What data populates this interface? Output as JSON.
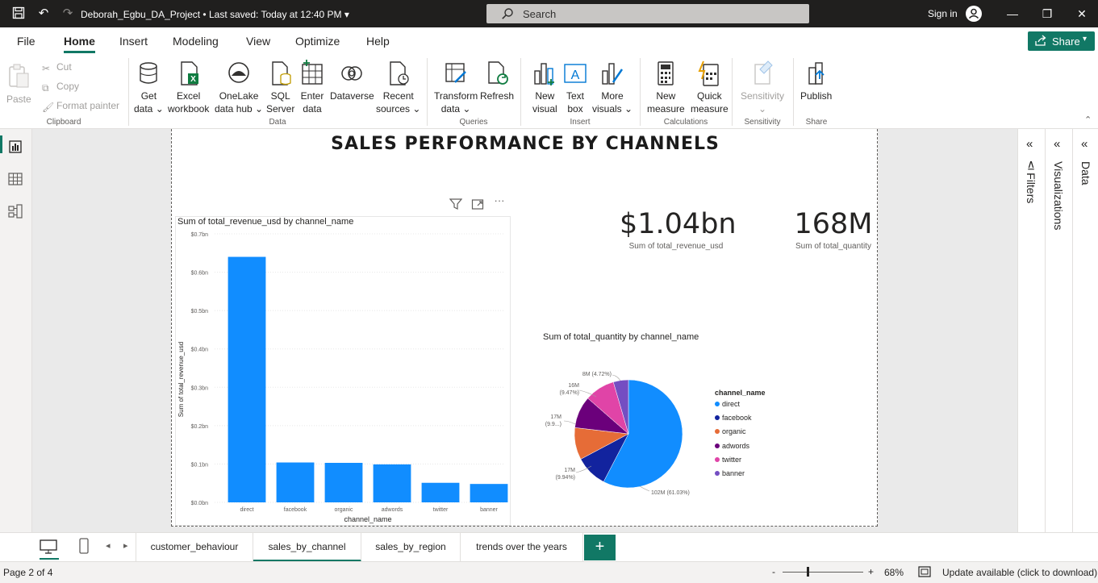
{
  "window": {
    "doc_title": "Deborah_Egbu_DA_Project • Last saved: Today at 12:40 PM",
    "search_placeholder": "Search",
    "sign_in": "Sign in"
  },
  "menu": {
    "tabs": [
      "File",
      "Home",
      "Insert",
      "Modeling",
      "View",
      "Optimize",
      "Help"
    ],
    "active": "Home",
    "share": "Share"
  },
  "ribbon": {
    "clipboard": {
      "label": "Clipboard",
      "paste": "Paste",
      "cut": "Cut",
      "copy": "Copy",
      "format_painter": "Format painter"
    },
    "data": {
      "label": "Data",
      "get_data": [
        "Get",
        "data ⌄"
      ],
      "excel": [
        "Excel",
        "workbook"
      ],
      "onelake": [
        "OneLake",
        "data hub ⌄"
      ],
      "sql": [
        "SQL",
        "Server"
      ],
      "enter": [
        "Enter",
        "data"
      ],
      "dataverse": "Dataverse",
      "recent": [
        "Recent",
        "sources ⌄"
      ]
    },
    "queries": {
      "label": "Queries",
      "transform": [
        "Transform",
        "data ⌄"
      ],
      "refresh": "Refresh"
    },
    "insert": {
      "label": "Insert",
      "new_visual": [
        "New",
        "visual"
      ],
      "text_box": [
        "Text",
        "box"
      ],
      "more_visuals": [
        "More",
        "visuals ⌄"
      ]
    },
    "calculations": {
      "label": "Calculations",
      "new_measure": [
        "New",
        "measure"
      ],
      "quick_measure": [
        "Quick",
        "measure"
      ]
    },
    "sensitivity": {
      "label": "Sensitivity",
      "btn": [
        "Sensitivity",
        "⌄"
      ]
    },
    "share": {
      "label": "Share",
      "publish": "Publish"
    }
  },
  "report": {
    "title": "SALES PERFORMANCE BY CHANNELS",
    "kpi_revenue": {
      "value": "$1.04bn",
      "label": "Sum of total_revenue_usd"
    },
    "kpi_quantity": {
      "value": "168M",
      "label": "Sum of total_quantity"
    },
    "pie_title": "Sum of total_quantity by channel_name",
    "legend_title": "channel_name",
    "pie_labels": {
      "banner": [
        "8M (4.72%)"
      ],
      "twitter": [
        "16M",
        "(9.47%)"
      ],
      "adwords": [
        "17M",
        "(9.9...)"
      ],
      "organic": [
        "17M",
        "(9.94%)"
      ],
      "direct": [
        "102M (61.03%)"
      ]
    }
  },
  "colors": {
    "accent": "#117865",
    "bar": "#118dff",
    "direct": "#118dff",
    "facebook": "#12239e",
    "organic": "#e66c37",
    "adwords": "#6b007b",
    "twitter": "#e044a7",
    "banner": "#744ec2"
  },
  "chart_data": [
    {
      "type": "bar",
      "title": "Sum of total_revenue_usd by channel_name",
      "xlabel": "channel_name",
      "ylabel": "Sum of total_revenue_usd",
      "categories": [
        "direct",
        "facebook",
        "organic",
        "adwords",
        "twitter",
        "banner"
      ],
      "values": [
        0.64,
        0.104,
        0.103,
        0.099,
        0.051,
        0.048
      ],
      "unit": "bn",
      "yticks": [
        "$0.0bn",
        "$0.1bn",
        "$0.2bn",
        "$0.3bn",
        "$0.4bn",
        "$0.5bn",
        "$0.6bn",
        "$0.7bn"
      ],
      "ylim": [
        0,
        0.7
      ],
      "grid": true
    },
    {
      "type": "pie",
      "title": "Sum of total_quantity by channel_name",
      "categories": [
        "direct",
        "facebook",
        "organic",
        "adwords",
        "twitter",
        "banner"
      ],
      "values": [
        102,
        17,
        17,
        17,
        16,
        8
      ],
      "percents": [
        61.03,
        9.9,
        9.94,
        9.9,
        9.47,
        4.72
      ],
      "legend": "right"
    }
  ],
  "pages": {
    "tabs": [
      "customer_behaviour",
      "sales_by_channel",
      "sales_by_region",
      "trends over the years"
    ],
    "active": "sales_by_channel",
    "add": "+"
  },
  "status": {
    "page": "Page 2 of 4",
    "zoom_minus": "-",
    "zoom_plus": "+",
    "zoom": "68%",
    "update": "Update available (click to download)"
  }
}
